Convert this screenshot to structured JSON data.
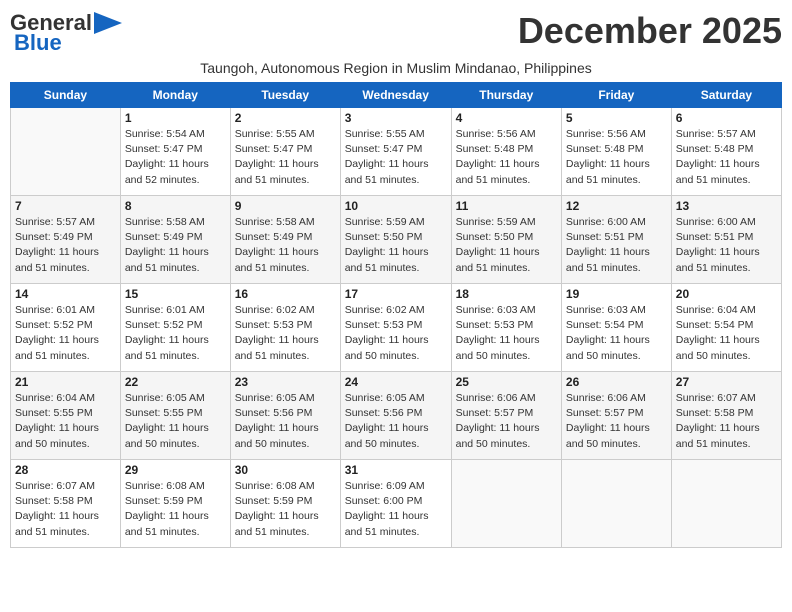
{
  "logo": {
    "general": "General",
    "blue": "Blue"
  },
  "title": "December 2025",
  "subtitle": "Taungoh, Autonomous Region in Muslim Mindanao, Philippines",
  "headers": [
    "Sunday",
    "Monday",
    "Tuesday",
    "Wednesday",
    "Thursday",
    "Friday",
    "Saturday"
  ],
  "weeks": [
    [
      {
        "day": "",
        "info": ""
      },
      {
        "day": "1",
        "info": "Sunrise: 5:54 AM\nSunset: 5:47 PM\nDaylight: 11 hours\nand 52 minutes."
      },
      {
        "day": "2",
        "info": "Sunrise: 5:55 AM\nSunset: 5:47 PM\nDaylight: 11 hours\nand 51 minutes."
      },
      {
        "day": "3",
        "info": "Sunrise: 5:55 AM\nSunset: 5:47 PM\nDaylight: 11 hours\nand 51 minutes."
      },
      {
        "day": "4",
        "info": "Sunrise: 5:56 AM\nSunset: 5:48 PM\nDaylight: 11 hours\nand 51 minutes."
      },
      {
        "day": "5",
        "info": "Sunrise: 5:56 AM\nSunset: 5:48 PM\nDaylight: 11 hours\nand 51 minutes."
      },
      {
        "day": "6",
        "info": "Sunrise: 5:57 AM\nSunset: 5:48 PM\nDaylight: 11 hours\nand 51 minutes."
      }
    ],
    [
      {
        "day": "7",
        "info": "Sunrise: 5:57 AM\nSunset: 5:49 PM\nDaylight: 11 hours\nand 51 minutes."
      },
      {
        "day": "8",
        "info": "Sunrise: 5:58 AM\nSunset: 5:49 PM\nDaylight: 11 hours\nand 51 minutes."
      },
      {
        "day": "9",
        "info": "Sunrise: 5:58 AM\nSunset: 5:49 PM\nDaylight: 11 hours\nand 51 minutes."
      },
      {
        "day": "10",
        "info": "Sunrise: 5:59 AM\nSunset: 5:50 PM\nDaylight: 11 hours\nand 51 minutes."
      },
      {
        "day": "11",
        "info": "Sunrise: 5:59 AM\nSunset: 5:50 PM\nDaylight: 11 hours\nand 51 minutes."
      },
      {
        "day": "12",
        "info": "Sunrise: 6:00 AM\nSunset: 5:51 PM\nDaylight: 11 hours\nand 51 minutes."
      },
      {
        "day": "13",
        "info": "Sunrise: 6:00 AM\nSunset: 5:51 PM\nDaylight: 11 hours\nand 51 minutes."
      }
    ],
    [
      {
        "day": "14",
        "info": "Sunrise: 6:01 AM\nSunset: 5:52 PM\nDaylight: 11 hours\nand 51 minutes."
      },
      {
        "day": "15",
        "info": "Sunrise: 6:01 AM\nSunset: 5:52 PM\nDaylight: 11 hours\nand 51 minutes."
      },
      {
        "day": "16",
        "info": "Sunrise: 6:02 AM\nSunset: 5:53 PM\nDaylight: 11 hours\nand 51 minutes."
      },
      {
        "day": "17",
        "info": "Sunrise: 6:02 AM\nSunset: 5:53 PM\nDaylight: 11 hours\nand 50 minutes."
      },
      {
        "day": "18",
        "info": "Sunrise: 6:03 AM\nSunset: 5:53 PM\nDaylight: 11 hours\nand 50 minutes."
      },
      {
        "day": "19",
        "info": "Sunrise: 6:03 AM\nSunset: 5:54 PM\nDaylight: 11 hours\nand 50 minutes."
      },
      {
        "day": "20",
        "info": "Sunrise: 6:04 AM\nSunset: 5:54 PM\nDaylight: 11 hours\nand 50 minutes."
      }
    ],
    [
      {
        "day": "21",
        "info": "Sunrise: 6:04 AM\nSunset: 5:55 PM\nDaylight: 11 hours\nand 50 minutes."
      },
      {
        "day": "22",
        "info": "Sunrise: 6:05 AM\nSunset: 5:55 PM\nDaylight: 11 hours\nand 50 minutes."
      },
      {
        "day": "23",
        "info": "Sunrise: 6:05 AM\nSunset: 5:56 PM\nDaylight: 11 hours\nand 50 minutes."
      },
      {
        "day": "24",
        "info": "Sunrise: 6:05 AM\nSunset: 5:56 PM\nDaylight: 11 hours\nand 50 minutes."
      },
      {
        "day": "25",
        "info": "Sunrise: 6:06 AM\nSunset: 5:57 PM\nDaylight: 11 hours\nand 50 minutes."
      },
      {
        "day": "26",
        "info": "Sunrise: 6:06 AM\nSunset: 5:57 PM\nDaylight: 11 hours\nand 50 minutes."
      },
      {
        "day": "27",
        "info": "Sunrise: 6:07 AM\nSunset: 5:58 PM\nDaylight: 11 hours\nand 51 minutes."
      }
    ],
    [
      {
        "day": "28",
        "info": "Sunrise: 6:07 AM\nSunset: 5:58 PM\nDaylight: 11 hours\nand 51 minutes."
      },
      {
        "day": "29",
        "info": "Sunrise: 6:08 AM\nSunset: 5:59 PM\nDaylight: 11 hours\nand 51 minutes."
      },
      {
        "day": "30",
        "info": "Sunrise: 6:08 AM\nSunset: 5:59 PM\nDaylight: 11 hours\nand 51 minutes."
      },
      {
        "day": "31",
        "info": "Sunrise: 6:09 AM\nSunset: 6:00 PM\nDaylight: 11 hours\nand 51 minutes."
      },
      {
        "day": "",
        "info": ""
      },
      {
        "day": "",
        "info": ""
      },
      {
        "day": "",
        "info": ""
      }
    ]
  ]
}
